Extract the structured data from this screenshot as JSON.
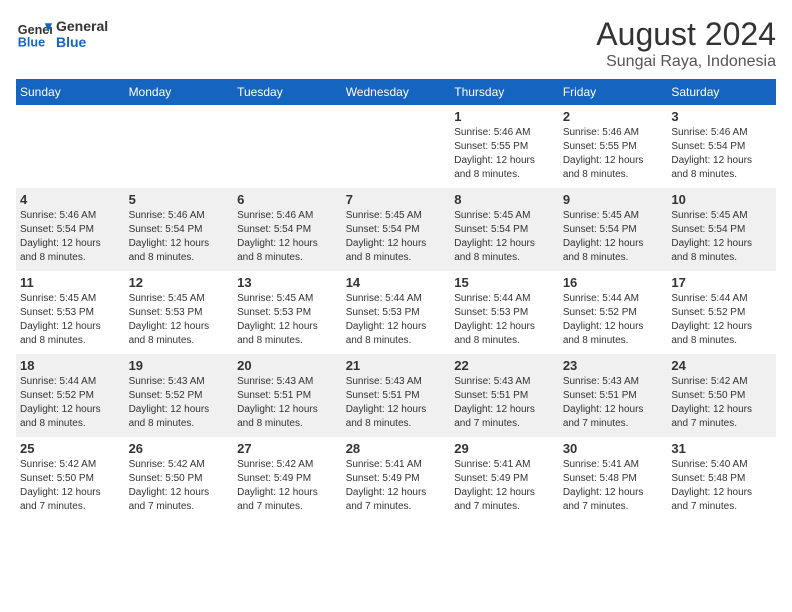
{
  "header": {
    "logo_line1": "General",
    "logo_line2": "Blue",
    "title": "August 2024",
    "subtitle": "Sungai Raya, Indonesia"
  },
  "weekdays": [
    "Sunday",
    "Monday",
    "Tuesday",
    "Wednesday",
    "Thursday",
    "Friday",
    "Saturday"
  ],
  "rows": [
    [
      {
        "day": "",
        "info": ""
      },
      {
        "day": "",
        "info": ""
      },
      {
        "day": "",
        "info": ""
      },
      {
        "day": "",
        "info": ""
      },
      {
        "day": "1",
        "info": "Sunrise: 5:46 AM\nSunset: 5:55 PM\nDaylight: 12 hours\nand 8 minutes."
      },
      {
        "day": "2",
        "info": "Sunrise: 5:46 AM\nSunset: 5:55 PM\nDaylight: 12 hours\nand 8 minutes."
      },
      {
        "day": "3",
        "info": "Sunrise: 5:46 AM\nSunset: 5:54 PM\nDaylight: 12 hours\nand 8 minutes."
      }
    ],
    [
      {
        "day": "4",
        "info": "Sunrise: 5:46 AM\nSunset: 5:54 PM\nDaylight: 12 hours\nand 8 minutes."
      },
      {
        "day": "5",
        "info": "Sunrise: 5:46 AM\nSunset: 5:54 PM\nDaylight: 12 hours\nand 8 minutes."
      },
      {
        "day": "6",
        "info": "Sunrise: 5:46 AM\nSunset: 5:54 PM\nDaylight: 12 hours\nand 8 minutes."
      },
      {
        "day": "7",
        "info": "Sunrise: 5:45 AM\nSunset: 5:54 PM\nDaylight: 12 hours\nand 8 minutes."
      },
      {
        "day": "8",
        "info": "Sunrise: 5:45 AM\nSunset: 5:54 PM\nDaylight: 12 hours\nand 8 minutes."
      },
      {
        "day": "9",
        "info": "Sunrise: 5:45 AM\nSunset: 5:54 PM\nDaylight: 12 hours\nand 8 minutes."
      },
      {
        "day": "10",
        "info": "Sunrise: 5:45 AM\nSunset: 5:54 PM\nDaylight: 12 hours\nand 8 minutes."
      }
    ],
    [
      {
        "day": "11",
        "info": "Sunrise: 5:45 AM\nSunset: 5:53 PM\nDaylight: 12 hours\nand 8 minutes."
      },
      {
        "day": "12",
        "info": "Sunrise: 5:45 AM\nSunset: 5:53 PM\nDaylight: 12 hours\nand 8 minutes."
      },
      {
        "day": "13",
        "info": "Sunrise: 5:45 AM\nSunset: 5:53 PM\nDaylight: 12 hours\nand 8 minutes."
      },
      {
        "day": "14",
        "info": "Sunrise: 5:44 AM\nSunset: 5:53 PM\nDaylight: 12 hours\nand 8 minutes."
      },
      {
        "day": "15",
        "info": "Sunrise: 5:44 AM\nSunset: 5:53 PM\nDaylight: 12 hours\nand 8 minutes."
      },
      {
        "day": "16",
        "info": "Sunrise: 5:44 AM\nSunset: 5:52 PM\nDaylight: 12 hours\nand 8 minutes."
      },
      {
        "day": "17",
        "info": "Sunrise: 5:44 AM\nSunset: 5:52 PM\nDaylight: 12 hours\nand 8 minutes."
      }
    ],
    [
      {
        "day": "18",
        "info": "Sunrise: 5:44 AM\nSunset: 5:52 PM\nDaylight: 12 hours\nand 8 minutes."
      },
      {
        "day": "19",
        "info": "Sunrise: 5:43 AM\nSunset: 5:52 PM\nDaylight: 12 hours\nand 8 minutes."
      },
      {
        "day": "20",
        "info": "Sunrise: 5:43 AM\nSunset: 5:51 PM\nDaylight: 12 hours\nand 8 minutes."
      },
      {
        "day": "21",
        "info": "Sunrise: 5:43 AM\nSunset: 5:51 PM\nDaylight: 12 hours\nand 8 minutes."
      },
      {
        "day": "22",
        "info": "Sunrise: 5:43 AM\nSunset: 5:51 PM\nDaylight: 12 hours\nand 7 minutes."
      },
      {
        "day": "23",
        "info": "Sunrise: 5:43 AM\nSunset: 5:51 PM\nDaylight: 12 hours\nand 7 minutes."
      },
      {
        "day": "24",
        "info": "Sunrise: 5:42 AM\nSunset: 5:50 PM\nDaylight: 12 hours\nand 7 minutes."
      }
    ],
    [
      {
        "day": "25",
        "info": "Sunrise: 5:42 AM\nSunset: 5:50 PM\nDaylight: 12 hours\nand 7 minutes."
      },
      {
        "day": "26",
        "info": "Sunrise: 5:42 AM\nSunset: 5:50 PM\nDaylight: 12 hours\nand 7 minutes."
      },
      {
        "day": "27",
        "info": "Sunrise: 5:42 AM\nSunset: 5:49 PM\nDaylight: 12 hours\nand 7 minutes."
      },
      {
        "day": "28",
        "info": "Sunrise: 5:41 AM\nSunset: 5:49 PM\nDaylight: 12 hours\nand 7 minutes."
      },
      {
        "day": "29",
        "info": "Sunrise: 5:41 AM\nSunset: 5:49 PM\nDaylight: 12 hours\nand 7 minutes."
      },
      {
        "day": "30",
        "info": "Sunrise: 5:41 AM\nSunset: 5:48 PM\nDaylight: 12 hours\nand 7 minutes."
      },
      {
        "day": "31",
        "info": "Sunrise: 5:40 AM\nSunset: 5:48 PM\nDaylight: 12 hours\nand 7 minutes."
      }
    ]
  ]
}
